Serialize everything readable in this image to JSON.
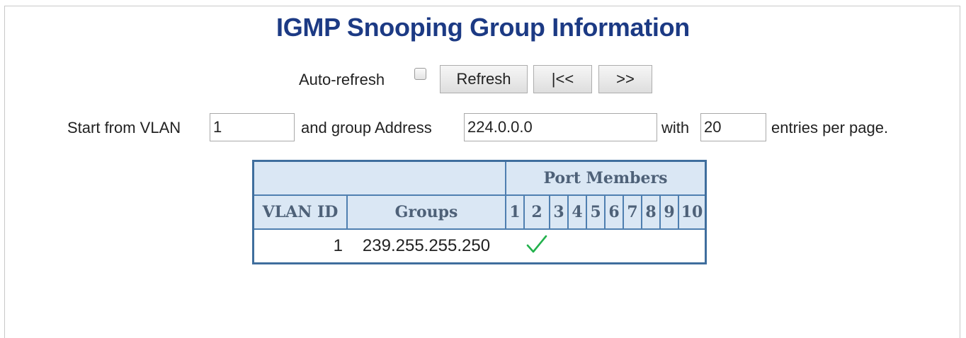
{
  "page": {
    "title": "IGMP Snooping Group Information"
  },
  "controls": {
    "auto_refresh_label": "Auto-refresh",
    "auto_refresh_checked": false,
    "refresh_button": "Refresh",
    "first_page_button": "|<<",
    "next_page_button": ">>"
  },
  "filter": {
    "start_vlan_label": "Start from VLAN",
    "start_vlan_value": "1",
    "group_address_label": "and group Address",
    "group_address_value": "224.0.0.0",
    "with_label": "with",
    "entries_value": "20",
    "entries_suffix": "entries per page."
  },
  "table": {
    "port_members_header": "Port Members",
    "vlan_id_header": "VLAN ID",
    "groups_header": "Groups",
    "ports": [
      "1",
      "2",
      "3",
      "4",
      "5",
      "6",
      "7",
      "8",
      "9",
      "10"
    ],
    "rows": [
      {
        "vlan_id": "1",
        "group": "239.255.255.250",
        "members": [
          false,
          true,
          false,
          false,
          false,
          false,
          false,
          false,
          false,
          false
        ]
      }
    ],
    "member_check_color": "#22b14c"
  }
}
